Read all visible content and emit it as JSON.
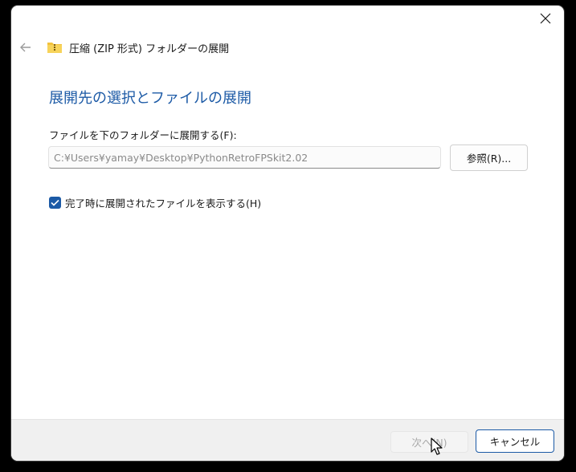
{
  "window": {
    "title": "圧縮 (ZIP 形式) フォルダーの展開",
    "back_icon": "back-arrow-icon",
    "folder_icon": "zip-folder-icon",
    "close_icon": "close-icon"
  },
  "main": {
    "heading": "展開先の選択とファイルの展開",
    "destination_label": "ファイルを下のフォルダーに展開する(F):",
    "destination_value": "C:¥Users¥yamay¥Desktop¥PythonRetroFPSkit2.02",
    "browse_label": "参照(R)...",
    "show_files_label": "完了時に展開されたファイルを表示する(H)",
    "show_files_checked": true
  },
  "footer": {
    "next_label": "次へ(N)",
    "cancel_label": "キャンセル"
  },
  "colors": {
    "accent": "#1c5aa6",
    "folder": "#f3c23c"
  }
}
